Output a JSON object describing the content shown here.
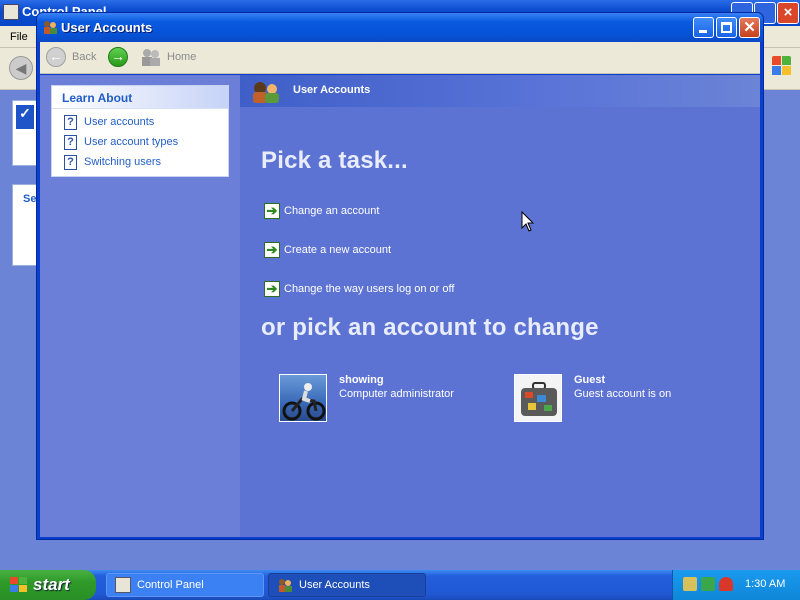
{
  "background_window": {
    "title": "Control Panel",
    "menu_file": "File",
    "left_panel_text": "Se"
  },
  "window": {
    "title": "User Accounts"
  },
  "nav": {
    "back_label": "Back",
    "home_label": "Home"
  },
  "learn_about": {
    "header": "Learn About",
    "items": [
      {
        "label": "User accounts"
      },
      {
        "label": "User account types"
      },
      {
        "label": "Switching users"
      }
    ]
  },
  "right_pane": {
    "header_title": "User Accounts",
    "pick_task_heading": "Pick a task...",
    "tasks": [
      {
        "label": "Change an account"
      },
      {
        "label": "Create a new account"
      },
      {
        "label": "Change the way users log on or off"
      }
    ],
    "pick_account_heading": "or pick an account to change",
    "accounts": [
      {
        "name": "showing",
        "description": "Computer administrator",
        "picture": "motocross-picture"
      },
      {
        "name": "Guest",
        "description": "Guest account is on",
        "picture": "suitcase-picture"
      }
    ]
  },
  "taskbar": {
    "start_label": "start",
    "buttons": [
      {
        "label": "Control Panel",
        "icon": "control-panel-icon",
        "active": false
      },
      {
        "label": "User Accounts",
        "icon": "user-accounts-icon",
        "active": true
      }
    ],
    "clock": "1:30 AM"
  },
  "colors": {
    "titlebar_blue": "#0653d8",
    "content_blue": "#5d73d4",
    "link_blue": "#215dc6",
    "start_green": "#2f9a2a"
  }
}
